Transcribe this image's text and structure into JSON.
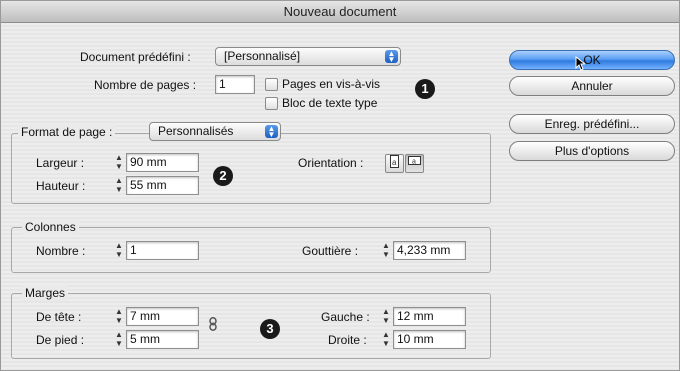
{
  "window": {
    "title": "Nouveau document"
  },
  "preset": {
    "label": "Document prédéfini :",
    "value": "[Personnalisé]"
  },
  "pages": {
    "label": "Nombre de pages :",
    "value": "1"
  },
  "facing_pages": {
    "label": "Pages en vis-à-vis",
    "checked": false
  },
  "master_text_frame": {
    "label": "Bloc de texte type",
    "checked": false
  },
  "page_size": {
    "group_label": "Format de page :",
    "value": "Personnalisés",
    "width_label": "Largeur :",
    "width_value": "90 mm",
    "height_label": "Hauteur :",
    "height_value": "55 mm",
    "orientation_label": "Orientation :"
  },
  "columns": {
    "group_label": "Colonnes",
    "number_label": "Nombre :",
    "number_value": "1",
    "gutter_label": "Gouttière :",
    "gutter_value": "4,233 mm"
  },
  "margins": {
    "group_label": "Marges",
    "top_label": "De tête :",
    "top_value": "7 mm",
    "bottom_label": "De pied :",
    "bottom_value": "5 mm",
    "left_label": "Gauche :",
    "left_value": "12 mm",
    "right_label": "Droite :",
    "right_value": "10 mm"
  },
  "buttons": {
    "ok": "OK",
    "cancel": "Annuler",
    "save_preset": "Enreg. prédéfini...",
    "more_options": "Plus d'options"
  },
  "badges": {
    "one": "1",
    "two": "2",
    "three": "3"
  },
  "icons": {
    "popup_arrows": "↕",
    "stepper_up": "▲",
    "stepper_down": "▼",
    "portrait": "portrait-icon",
    "landscape": "landscape-icon",
    "chain": "chain-link-icon"
  },
  "colors": {
    "accent": "#2f7be0",
    "badge": "#1a1a1a"
  }
}
